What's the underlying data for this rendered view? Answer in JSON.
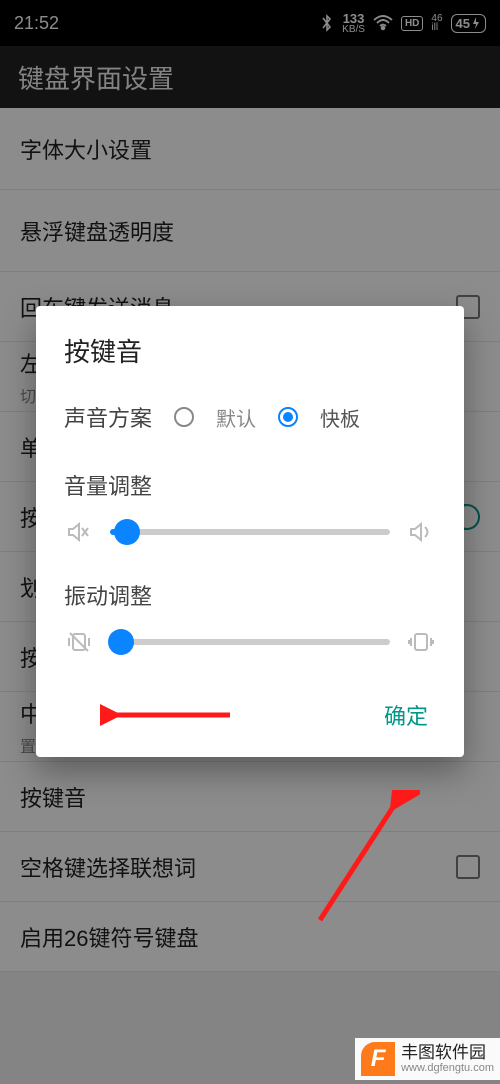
{
  "statusbar": {
    "time": "21:52",
    "net_rate_value": "133",
    "net_rate_unit": "KB/S",
    "hd": "HD",
    "sig_top": "46",
    "sig_bottom": "ill",
    "battery": "45"
  },
  "page_title": "键盘界面设置",
  "rows": {
    "font_size": "字体大小设置",
    "float_opacity": "悬浮键盘透明度",
    "enter_send": "回车键发送消息",
    "left_label": "左",
    "left_sub": "切",
    "single": "单",
    "press": "按",
    "swipe": "划",
    "press2": "按",
    "mid_label": "中",
    "mid_sub": "置于面板顶部",
    "key_sound": "按键音",
    "space_assoc": "空格键选择联想词",
    "enable_26": "启用26键符号键盘"
  },
  "dialog": {
    "title": "按键音",
    "scheme_label": "声音方案",
    "radio_default": "默认",
    "radio_kuaiban": "快板",
    "radio_selected": "kuaiban",
    "volume_label": "音量调整",
    "vibration_label": "振动调整",
    "volume_percent": 6,
    "vibration_percent": 4,
    "ok": "确定"
  },
  "watermark": {
    "f": "F",
    "name": "丰图软件园",
    "url": "www.dgfengtu.com"
  },
  "icons": {
    "bluetooth": "bluetooth-icon",
    "wifi": "wifi-icon",
    "mute": "volume-mute-icon",
    "speaker": "speaker-icon",
    "vibe_off": "vibrate-mute-icon",
    "vibe": "vibrate-icon"
  }
}
